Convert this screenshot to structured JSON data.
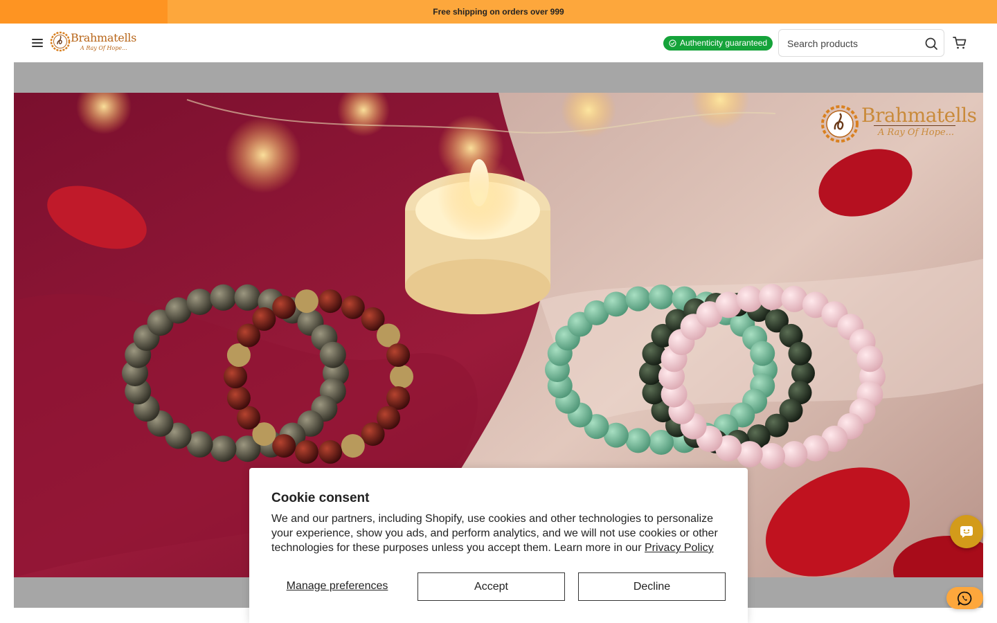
{
  "announcement": {
    "text": "Free shipping on orders over 999"
  },
  "header": {
    "menu_icon": "hamburger-menu-icon",
    "logo": {
      "name": "Brahmatells",
      "tagline": "A Ray Of Hope..."
    },
    "badge": {
      "text": "Authenticity guaranteed",
      "icon": "check-circle-icon",
      "color": "#15a33a"
    },
    "search": {
      "placeholder": "Search products",
      "icon": "search-icon"
    },
    "cart_icon": "cart-icon"
  },
  "hero": {
    "watermark_logo": {
      "name": "Brahmatells",
      "tagline": "A Ray Of Hope..."
    }
  },
  "cookie_banner": {
    "title": "Cookie consent",
    "body": "We and our partners, including Shopify, use cookies and other technologies to personalize your experience, show you ads, and perform analytics, and we will not use cookies or other technologies for these purposes unless you accept them. Learn more in our ",
    "privacy_link": "Privacy Policy",
    "manage_label": "Manage preferences",
    "accept_label": "Accept",
    "decline_label": "Decline"
  },
  "floating": {
    "chat_icon": "chat-bot-icon",
    "whatsapp_icon": "whatsapp-icon"
  },
  "colors": {
    "announcement_bg": "#fda73c",
    "announcement_accent": "#fe9422",
    "chat_bubble": "#d39b1a"
  }
}
